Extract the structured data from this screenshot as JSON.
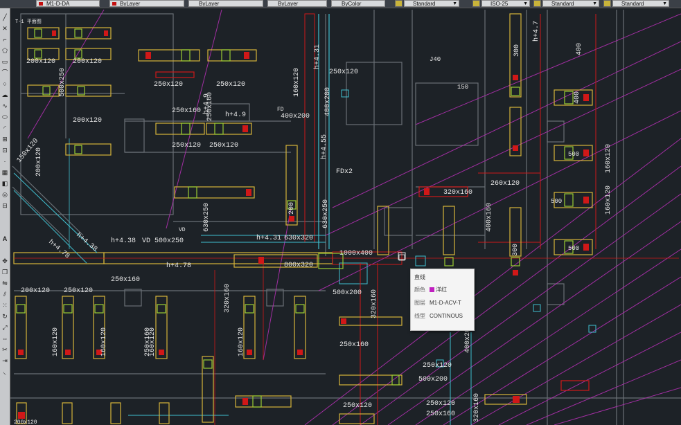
{
  "toolbar": {
    "layer_field": "M1-D-DA",
    "color_field": "ByLayer",
    "linetype_field": "ByLayer",
    "lineweight_field": "ByLayer",
    "plotstyle_field": "ByColor",
    "text_style": "Standard",
    "dim_style": "ISO-25",
    "table_style": "Standard",
    "mleader_style": "Standard"
  },
  "drawing": {
    "title": "T-1 平面图",
    "labels": {
      "l1": "200x120",
      "l2": "200x120",
      "l3": "500x250",
      "l4": "250x120",
      "l5": "250x120",
      "l6": "250x160",
      "l7": "250x160",
      "l8": "h+4.9",
      "l9": "200x120",
      "l10": "250x120",
      "l11": "250x120",
      "l12": "200x120",
      "l13": "630x250",
      "l14": "h+4.38",
      "l15": "h+4.78",
      "l16": "h+4.38",
      "l17": "VD 500x250",
      "l18": "h+4.78",
      "l19": "250x160",
      "l20": "200x120",
      "l21": "250x120",
      "l22": "160x120",
      "l23": "160x120",
      "l24": "160x120",
      "l25": "160x120",
      "l26": "320x160",
      "l27": "h+4.31",
      "l28": "630x320",
      "l29": "1000x400",
      "l30": "800x320",
      "l31": "630x250",
      "l32": "250x120",
      "l33": "400x200",
      "l34": "160x120",
      "l35": "h+4.31",
      "l36": "400x200",
      "l37": "h+4.55",
      "l38": "FDx2",
      "l39": "500x200",
      "l40": "320x160",
      "l41": "250x160",
      "l42": "250x120",
      "l43": "500x200",
      "l44": "250x120",
      "l45": "150x120",
      "l46": "250x160",
      "l47": "320x160",
      "l48": "260x120",
      "l49": "400x160",
      "l50": "h+4.7",
      "l51": "300",
      "l52": "400",
      "l53": "400",
      "l54": "500",
      "l55": "160x120",
      "l56": "160x120",
      "l57": "500",
      "l58": "500",
      "l59": "VD",
      "l60": "FD",
      "l61": "400x200",
      "l62": "300",
      "l63": "200",
      "l64": "h+4.9",
      "l65": "250x120",
      "l66": "250x160",
      "l67": "320x160",
      "l68": "J40",
      "l69": "150",
      "l70": "200x120"
    }
  },
  "tooltip": {
    "title": "直线",
    "color_label": "颜色",
    "color_value": "洋红",
    "layer_label": "图层",
    "layer_value": "M1-D-ACV-T",
    "linetype_label": "线型",
    "linetype_value": "CONTINOUS",
    "color_hex": "#c020c0"
  },
  "colors": {
    "background": "#1d2227",
    "duct": "#d6b43a",
    "duct_green": "#9acd32",
    "red": "#d01818",
    "magenta": "#b030b0",
    "cyan": "#40c0d0",
    "wall": "#6a7076",
    "text": "#e8e8e8"
  }
}
